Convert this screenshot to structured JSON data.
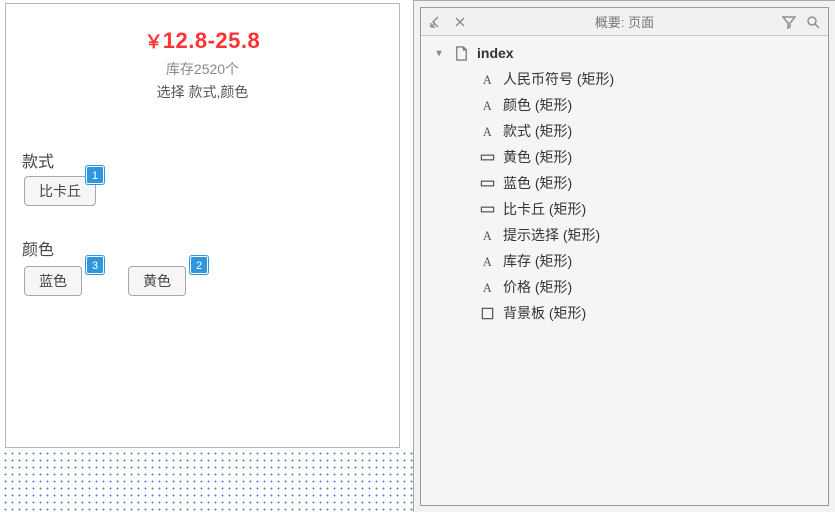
{
  "canvas": {
    "currency": "￥",
    "price": "12.8-25.8",
    "stock": "库存2520个",
    "hint": "选择 款式,颜色",
    "style_label": "款式",
    "color_label": "颜色",
    "chip_bika": "比卡丘",
    "chip_blue": "蓝色",
    "chip_yellow": "黄色",
    "badge1": "1",
    "badge2": "2",
    "badge3": "3"
  },
  "panel": {
    "title": "概要: 页面",
    "root": "index",
    "items": [
      {
        "icon": "text",
        "label": "人民币符号 (矩形)"
      },
      {
        "icon": "text",
        "label": "颜色 (矩形)"
      },
      {
        "icon": "text",
        "label": "款式 (矩形)"
      },
      {
        "icon": "rect-wide",
        "label": "黄色 (矩形)"
      },
      {
        "icon": "rect-wide",
        "label": "蓝色 (矩形)"
      },
      {
        "icon": "rect-wide",
        "label": "比卡丘 (矩形)"
      },
      {
        "icon": "text",
        "label": "提示选择 (矩形)"
      },
      {
        "icon": "text",
        "label": "库存 (矩形)"
      },
      {
        "icon": "text",
        "label": "价格 (矩形)"
      },
      {
        "icon": "rect",
        "label": "背景板 (矩形)"
      }
    ]
  }
}
